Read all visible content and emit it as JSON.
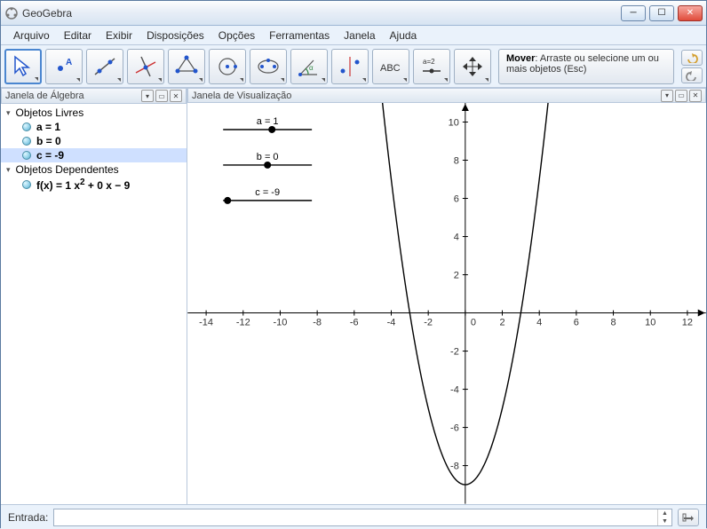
{
  "app": {
    "title": "GeoGebra"
  },
  "menu": [
    "Arquivo",
    "Editar",
    "Exibir",
    "Disposições",
    "Opções",
    "Ferramentas",
    "Janela",
    "Ajuda"
  ],
  "toolbar_hint": {
    "title": "Mover",
    "desc": ": Arraste ou selecione um ou mais objetos (Esc)"
  },
  "panels": {
    "algebra_title": "Janela de Álgebra",
    "graphics_title": "Janela de Visualização"
  },
  "algebra": {
    "free_title": "Objetos Livres",
    "dep_title": "Objetos Dependentes",
    "free": [
      {
        "label": "a = 1",
        "selected": false
      },
      {
        "label": "b = 0",
        "selected": false
      },
      {
        "label": "c = -9",
        "selected": true
      }
    ],
    "dependent_html": "f(x) = 1 x² + 0 x − 9"
  },
  "sliders": [
    {
      "label": "a = 1",
      "pos": 0.55
    },
    {
      "label": "b = 0",
      "pos": 0.5
    },
    {
      "label": "c = -9",
      "pos": 0.05
    }
  ],
  "chart_data": {
    "type": "line",
    "title": "",
    "xlabel": "",
    "ylabel": "",
    "xlim": [
      -15,
      13
    ],
    "ylim": [
      -10,
      11
    ],
    "xticks": [
      -14,
      -12,
      -10,
      -8,
      -6,
      -4,
      -2,
      0,
      2,
      4,
      6,
      8,
      10,
      12
    ],
    "yticks": [
      -8,
      -6,
      -4,
      -2,
      2,
      4,
      6,
      8,
      10
    ],
    "origin_label": "0",
    "series": [
      {
        "name": "f(x)=1x²+0x−9",
        "formula": "x^2 - 9"
      }
    ]
  },
  "input": {
    "label": "Entrada:",
    "value": ""
  }
}
